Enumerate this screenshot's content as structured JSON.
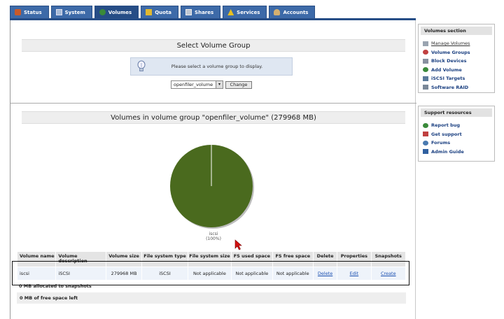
{
  "tabs": [
    {
      "label": "Status",
      "icon": "status-icon",
      "color": "#c85a2a"
    },
    {
      "label": "System",
      "icon": "system-icon",
      "color": "#5a7fb0"
    },
    {
      "label": "Volumes",
      "icon": "volumes-icon",
      "color": "#3a8a3a",
      "active": true
    },
    {
      "label": "Quota",
      "icon": "quota-icon",
      "color": "#c8a020"
    },
    {
      "label": "Shares",
      "icon": "shares-icon",
      "color": "#8a9ab0"
    },
    {
      "label": "Services",
      "icon": "services-icon",
      "color": "#d0b020"
    },
    {
      "label": "Accounts",
      "icon": "accounts-icon",
      "color": "#c0a060"
    }
  ],
  "select_section": {
    "title": "Select Volume Group",
    "message": "Please select a volume group to display.",
    "selected_value": "openfiler_volume",
    "change_label": "Change"
  },
  "volumes_section": {
    "title": "Volumes in volume group \"openfiler_volume\" (279968 MB)"
  },
  "chart_data": {
    "type": "pie",
    "slices": [
      {
        "label": "iscsi",
        "value": 100,
        "display": "(100%)",
        "color": "#4a6a1e"
      }
    ]
  },
  "table": {
    "headers": [
      "Volume name",
      "Volume description",
      "Volume size",
      "File system type",
      "File system size",
      "FS used space",
      "FS free space",
      "Delete",
      "Properties",
      "Snapshots"
    ],
    "rows": [
      {
        "name": "iscsi",
        "description": "iSCSI",
        "size": "279968 MB",
        "fs_type": "iSCSI",
        "fs_size": "Not applicable",
        "fs_used": "Not applicable",
        "fs_free": "Not applicable",
        "delete": "Delete",
        "properties": "Edit",
        "snapshots": "Create"
      }
    ],
    "snapshot_note": "0 MB allocated to snapshots",
    "free_space": "0 MB of free space left"
  },
  "sidebar": {
    "volumes": {
      "title": "Volumes section",
      "items": [
        {
          "label": "Manage Volumes",
          "icon": "manage-volumes-icon",
          "current": true
        },
        {
          "label": "Volume Groups",
          "icon": "volume-groups-icon"
        },
        {
          "label": "Block Devices",
          "icon": "block-devices-icon"
        },
        {
          "label": "Add Volume",
          "icon": "add-volume-icon"
        },
        {
          "label": "iSCSI Targets",
          "icon": "iscsi-targets-icon"
        },
        {
          "label": "Software RAID",
          "icon": "software-raid-icon"
        }
      ]
    },
    "support": {
      "title": "Support resources",
      "items": [
        {
          "label": "Report bug",
          "icon": "report-bug-icon"
        },
        {
          "label": "Get support",
          "icon": "get-support-icon"
        },
        {
          "label": "Forums",
          "icon": "forums-icon"
        },
        {
          "label": "Admin Guide",
          "icon": "admin-guide-icon"
        }
      ]
    }
  }
}
